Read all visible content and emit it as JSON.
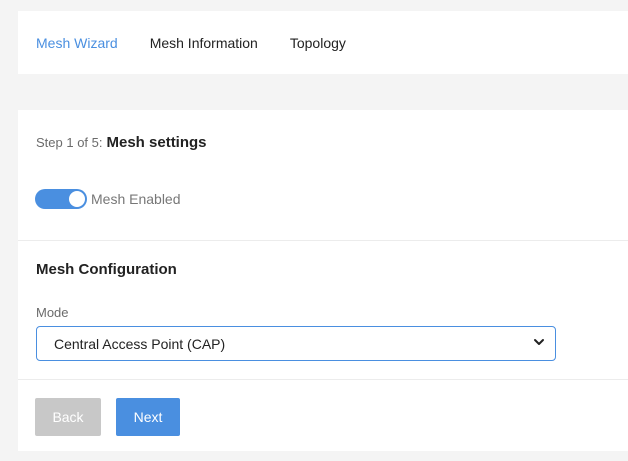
{
  "tabs": [
    {
      "label": "Mesh Wizard",
      "active": true
    },
    {
      "label": "Mesh Information",
      "active": false
    },
    {
      "label": "Topology",
      "active": false
    }
  ],
  "step": {
    "prefix": "Step 1 of 5:",
    "title": "Mesh settings"
  },
  "mesh_toggle": {
    "label": "Mesh Enabled",
    "enabled": true
  },
  "config": {
    "section_title": "Mesh Configuration",
    "mode_label": "Mode",
    "mode_value": "Central Access Point (CAP)"
  },
  "buttons": {
    "back": "Back",
    "next": "Next"
  },
  "colors": {
    "accent": "#4a8fe0",
    "disabled_button": "#c8c8c8"
  }
}
